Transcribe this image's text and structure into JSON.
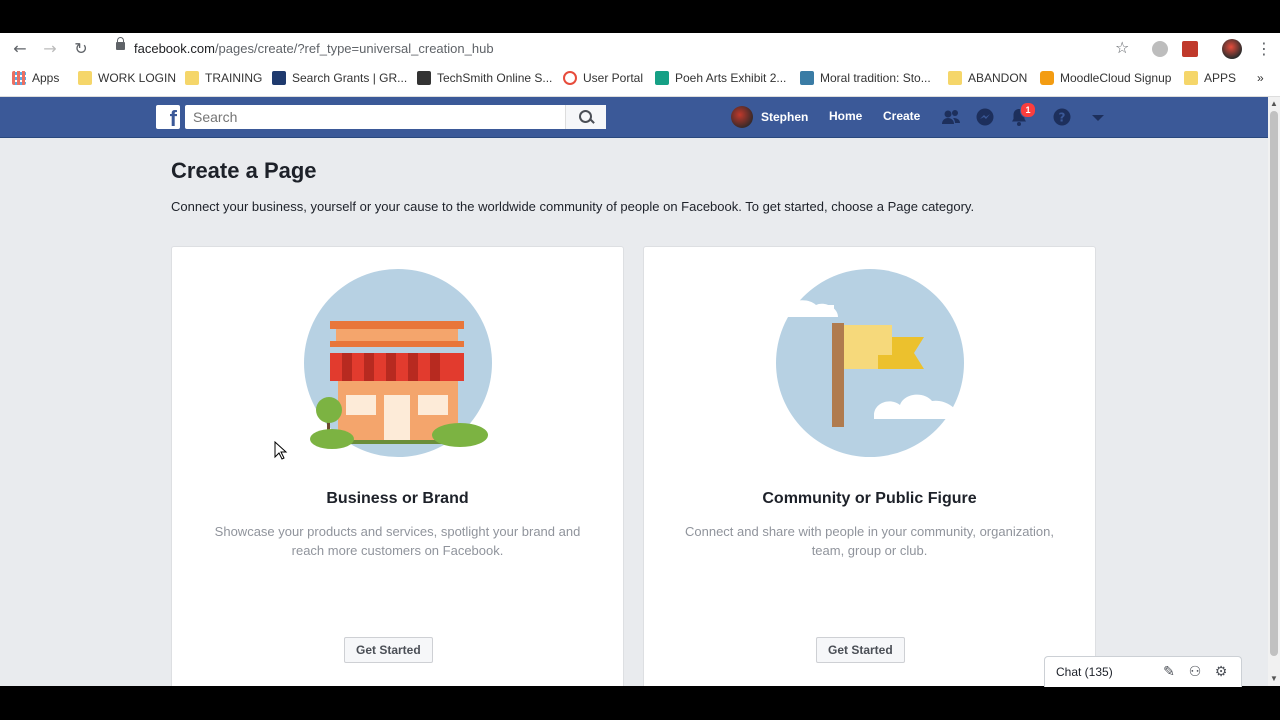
{
  "browser": {
    "url_host": "facebook.com",
    "url_path": "/pages/create/?ref_type=universal_creation_hub",
    "bookmarks": [
      {
        "label": "Apps",
        "icon": "apps-grid-icon"
      },
      {
        "label": "WORK LOGIN",
        "icon": "folder-icon"
      },
      {
        "label": "TRAINING",
        "icon": "folder-icon"
      },
      {
        "label": "Search Grants | GR...",
        "icon": "grants-icon"
      },
      {
        "label": "TechSmith Online S...",
        "icon": "techsmith-icon"
      },
      {
        "label": "User Portal",
        "icon": "portal-icon"
      },
      {
        "label": "Poeh Arts Exhibit 2...",
        "icon": "sheet-icon"
      },
      {
        "label": "Moral tradition: Sto...",
        "icon": "sfnm-icon"
      },
      {
        "label": "ABANDON",
        "icon": "folder-icon"
      },
      {
        "label": "MoodleCloud Signup",
        "icon": "moodle-icon"
      },
      {
        "label": "APPS",
        "icon": "folder-icon"
      }
    ],
    "overflow": "»"
  },
  "fb_header": {
    "search_placeholder": "Search",
    "user_name": "Stephen",
    "home_label": "Home",
    "create_label": "Create",
    "notification_count": "1"
  },
  "main": {
    "title": "Create a Page",
    "subtitle": "Connect your business, yourself or your cause to the worldwide community of people on Facebook. To get started, choose a Page category.",
    "cards": [
      {
        "title": "Business or Brand",
        "description": "Showcase your products and services, spotlight your brand and reach more customers on Facebook.",
        "button": "Get Started",
        "icon": "storefront-icon"
      },
      {
        "title": "Community or Public Figure",
        "description": "Connect and share with people in your community, organization, team, group or club.",
        "button": "Get Started",
        "icon": "flag-icon"
      }
    ]
  },
  "chat": {
    "label": "Chat (135)"
  },
  "colors": {
    "facebook_blue": "#3b5998",
    "page_bg": "#e9ebee",
    "notification_red": "#fa3e3e"
  }
}
